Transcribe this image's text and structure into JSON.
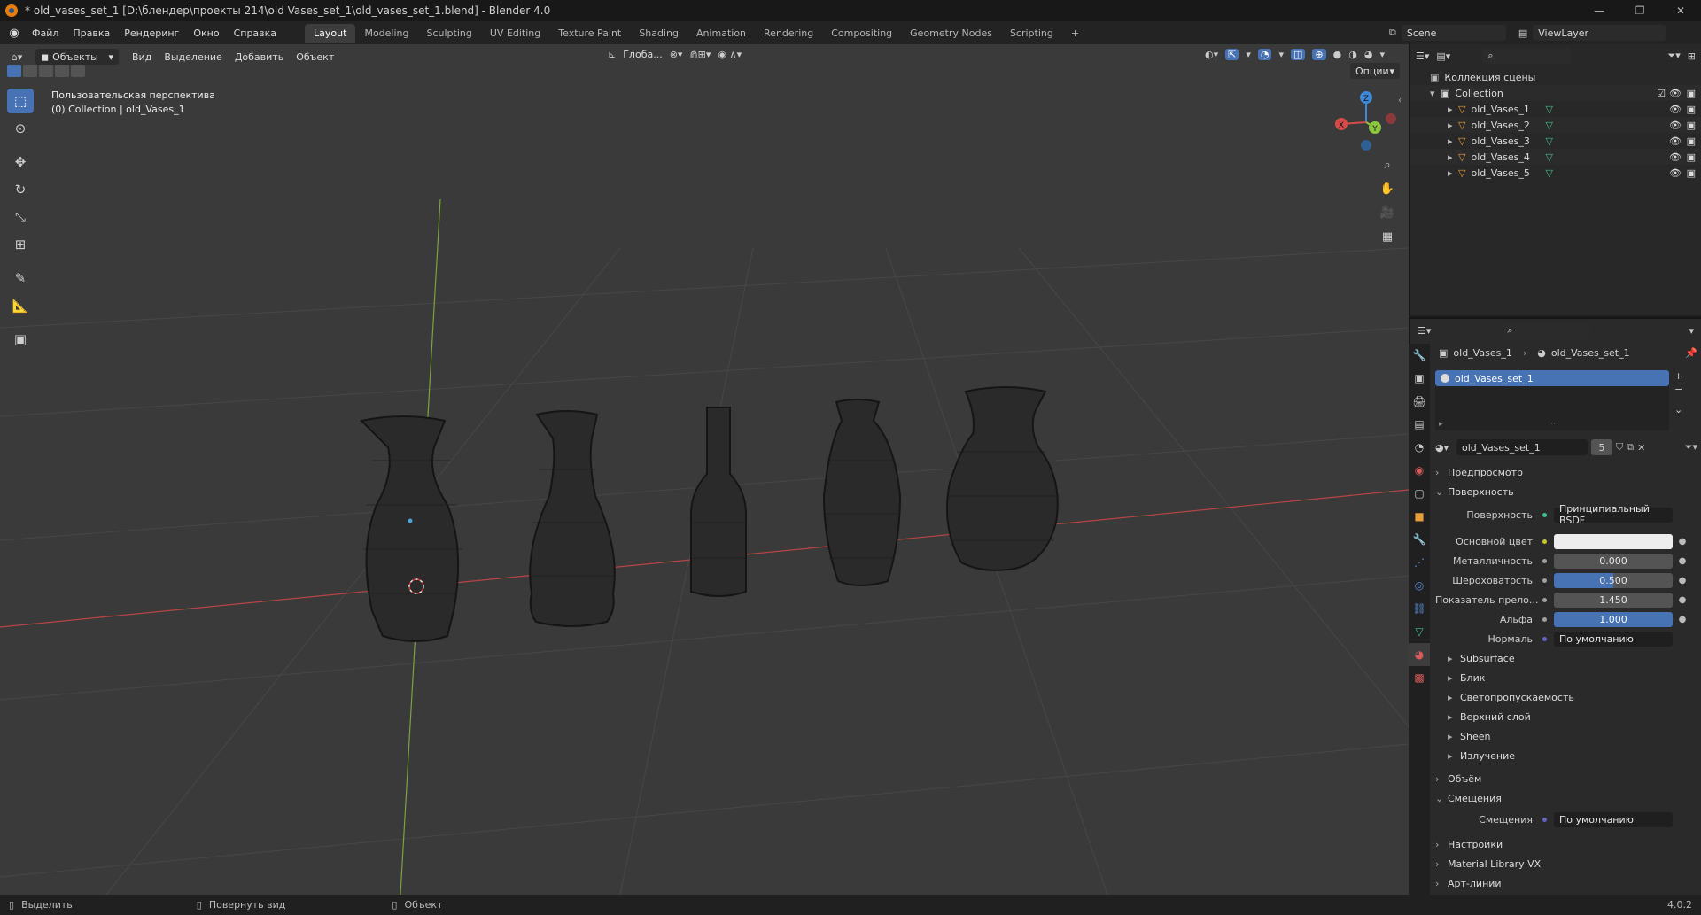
{
  "window": {
    "title": "* old_vases_set_1 [D:\\блендер\\проекты 214\\old Vases_set_1\\old_vases_set_1.blend] - Blender 4.0"
  },
  "menu": {
    "items": [
      "Файл",
      "Правка",
      "Рендеринг",
      "Окно",
      "Справка"
    ]
  },
  "workspaces": {
    "tabs": [
      "Layout",
      "Modeling",
      "Sculpting",
      "UV Editing",
      "Texture Paint",
      "Shading",
      "Animation",
      "Rendering",
      "Compositing",
      "Geometry Nodes",
      "Scripting"
    ],
    "active": "Layout"
  },
  "scene": {
    "name": "Scene",
    "view_layer": "ViewLayer"
  },
  "viewport_header": {
    "mode": "Объекты",
    "menus": [
      "Вид",
      "Выделение",
      "Добавить",
      "Объект"
    ],
    "transform_orientation": "Глоба...",
    "options": "Опции"
  },
  "viewport_info": {
    "line1": "Пользовательская перспектива",
    "line2": "(0) Collection | old_Vases_1"
  },
  "gizmo": {
    "x": "X",
    "y": "Y",
    "z": "Z"
  },
  "outliner": {
    "root": "Коллекция сцены",
    "collection": "Collection",
    "objects": [
      "old_Vases_1",
      "old_Vases_2",
      "old_Vases_3",
      "old_Vases_4",
      "old_Vases_5"
    ]
  },
  "properties": {
    "breadcrumb_object": "old_Vases_1",
    "breadcrumb_material": "old_Vases_set_1",
    "material_slot": "old_Vases_set_1",
    "material_name": "old_Vases_set_1",
    "users": "5",
    "sections": {
      "preview": "Предпросмотр",
      "surface": "Поверхность",
      "volume": "Объём",
      "displacement": "Смещения",
      "settings": "Настройки",
      "material_library": "Material Library VX",
      "lineart": "Арт-линии"
    },
    "surface_label": "Поверхность",
    "surface_value": "Принципиальный BSDF",
    "rows": [
      {
        "label": "Основной цвет",
        "value": "",
        "dot": "#c7c729",
        "kind": "color"
      },
      {
        "label": "Металличность",
        "value": "0.000",
        "dot": "#a1a1a1",
        "kind": "num"
      },
      {
        "label": "Шероховатость",
        "value": "0.500",
        "dot": "#a1a1a1",
        "kind": "blue"
      },
      {
        "label": "Показатель прело...",
        "value": "1.450",
        "dot": "#a1a1a1",
        "kind": "num"
      },
      {
        "label": "Альфа",
        "value": "1.000",
        "dot": "#a1a1a1",
        "kind": "blue"
      },
      {
        "label": "Нормаль",
        "value": "По умолчанию",
        "dot": "#6363c7",
        "kind": "dark"
      }
    ],
    "subpanels": [
      "Subsurface",
      "Блик",
      "Светопропускаемость",
      "Верхний слой",
      "Sheen",
      "Излучение"
    ],
    "displacement_label": "Смещения",
    "displacement_value": "По умолчанию"
  },
  "statusbar": {
    "select": "Выделить",
    "rotate": "Повернуть вид",
    "object": "Объект",
    "version": "4.0.2"
  },
  "colors": {
    "accent": "#4772b3",
    "viewport_bg": "#3a3a3a",
    "x_axis": "#d84a4a",
    "y_axis": "#8dc73f",
    "z_axis": "#3f88d8"
  }
}
